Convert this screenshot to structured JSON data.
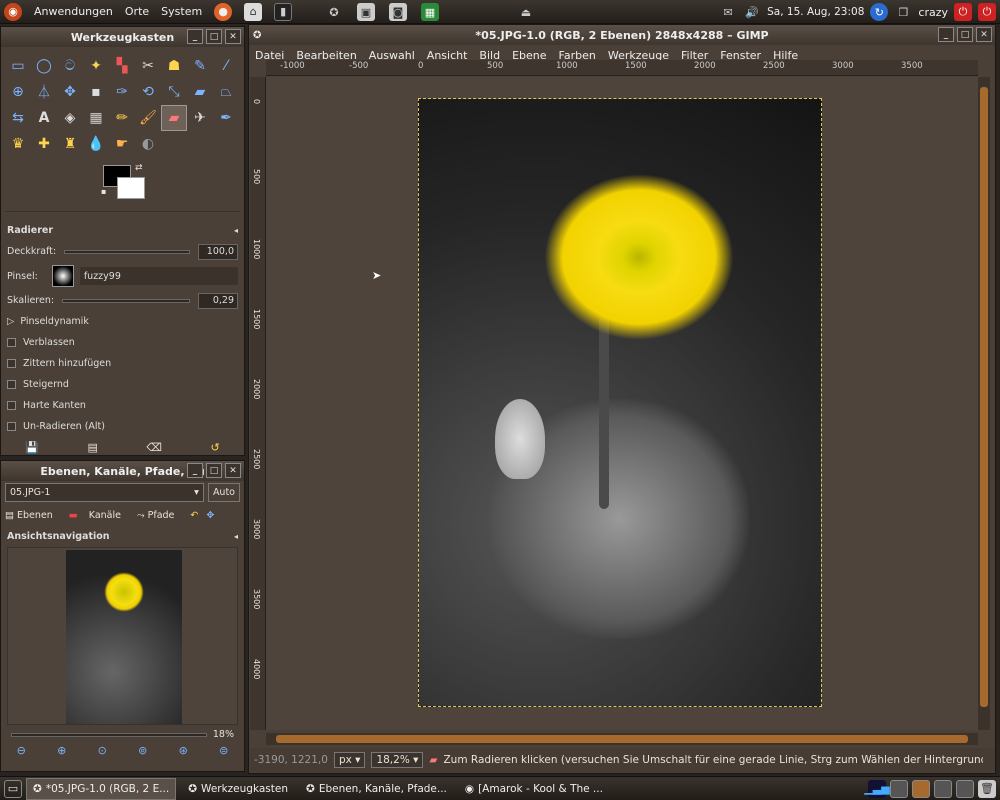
{
  "top_panel": {
    "menu": [
      "Anwendungen",
      "Orte",
      "System"
    ],
    "clock": "Sa, 15. Aug, 23:08",
    "user": "crazy"
  },
  "toolbox": {
    "title": "Werkzeugkasten"
  },
  "tool_options": {
    "title": "Radierer",
    "opacity_label": "Deckkraft:",
    "opacity_value": "100,0",
    "brush_label": "Pinsel:",
    "brush_name": "fuzzy99",
    "scale_label": "Skalieren:",
    "scale_value": "0,29",
    "dynamics": "Pinseldynamik",
    "opt1": "Verblassen",
    "opt2": "Zittern hinzufügen",
    "opt3": "Steigernd",
    "opt4": "Harte Kanten",
    "opt5": "Un-Radieren (Alt)"
  },
  "layers_dock": {
    "title": "Ebenen, Kanäle, Pfade, Rü",
    "image": "05.JPG-1",
    "auto": "Auto",
    "tab1": "Ebenen",
    "tab2": "Kanäle",
    "tab3": "Pfade",
    "nav_title": "Ansichtsnavigation",
    "zoom_pct": "18%"
  },
  "image_window": {
    "title": "*05.JPG-1.0 (RGB, 2 Ebenen) 2848x4288 – GIMP",
    "menus": [
      "Datei",
      "Bearbeiten",
      "Auswahl",
      "Ansicht",
      "Bild",
      "Ebene",
      "Farben",
      "Werkzeuge",
      "Filter",
      "Fenster",
      "Hilfe"
    ],
    "ruler_labels": [
      "-1000",
      "-500",
      "0",
      "500",
      "1000",
      "1500",
      "2000",
      "2500",
      "3000",
      "3500"
    ],
    "vruler_labels": [
      "0",
      "500",
      "1000",
      "1500",
      "2000",
      "2500",
      "3000",
      "3500",
      "4000"
    ]
  },
  "status": {
    "coords": "-3190, 1221,0",
    "unit": "px",
    "zoom": "18,2%",
    "message": "Zum Radieren klicken (versuchen Sie Umschalt für eine gerade Linie, Strg zum Wählen der Hintergrundf..."
  },
  "taskbar": {
    "t1": "*05.JPG-1.0 (RGB, 2 E...",
    "t2": "Werkzeugkasten",
    "t3": "Ebenen, Kanäle, Pfade...",
    "t4": "[Amarok - Kool & The ..."
  }
}
